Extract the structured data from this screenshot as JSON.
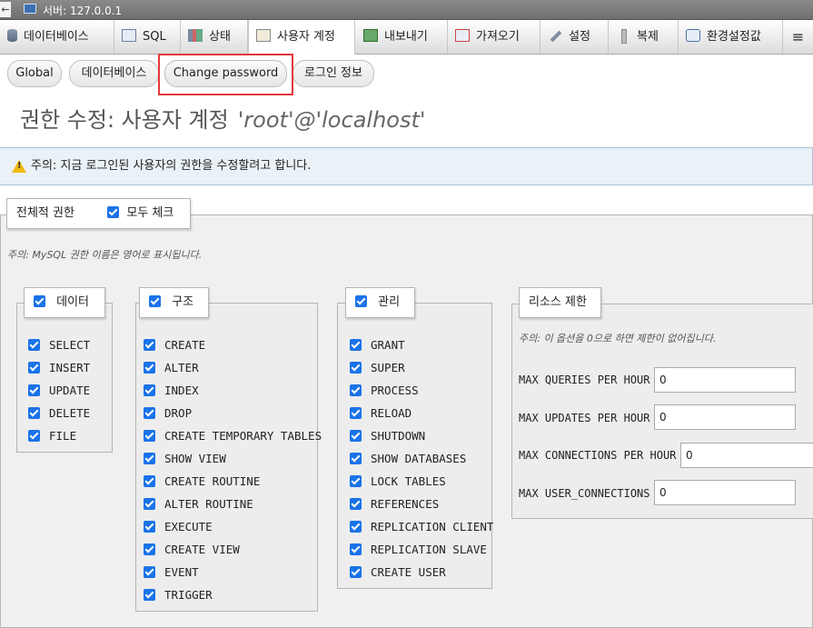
{
  "server_bar": {
    "title": "서버: 127.0.0.1"
  },
  "tabs": [
    {
      "label": "데이터베이스",
      "icon": "database-icon"
    },
    {
      "label": "SQL",
      "icon": "sql-icon"
    },
    {
      "label": "상태",
      "icon": "status-icon"
    },
    {
      "label": "사용자 계정",
      "icon": "users-icon",
      "active": true
    },
    {
      "label": "내보내기",
      "icon": "export-icon"
    },
    {
      "label": "가져오기",
      "icon": "import-icon"
    },
    {
      "label": "설정",
      "icon": "settings-icon"
    },
    {
      "label": "복제",
      "icon": "replication-icon"
    },
    {
      "label": "환경설정값",
      "icon": "variables-icon"
    },
    {
      "label": "",
      "icon": "more-icon"
    }
  ],
  "subtabs": [
    "Global",
    "데이터베이스",
    "Change password",
    "로그인 정보"
  ],
  "page": {
    "title": "권한 수정: 사용자 계정",
    "account": "'root'@'localhost'"
  },
  "notice": "주의: 지금 로그인된 사용자의 권한을 수정할려고 합니다.",
  "global": {
    "legend": "전체적 권한",
    "check_all": "모두 체크",
    "note": "주의: MySQL 권한 이름은 영어로 표시됩니다."
  },
  "groups": {
    "data": {
      "legend": "데이터",
      "items": [
        "SELECT",
        "INSERT",
        "UPDATE",
        "DELETE",
        "FILE"
      ]
    },
    "structure": {
      "legend": "구조",
      "items": [
        "CREATE",
        "ALTER",
        "INDEX",
        "DROP",
        "CREATE TEMPORARY TABLES",
        "SHOW VIEW",
        "CREATE ROUTINE",
        "ALTER ROUTINE",
        "EXECUTE",
        "CREATE VIEW",
        "EVENT",
        "TRIGGER"
      ]
    },
    "admin": {
      "legend": "관리",
      "items": [
        "GRANT",
        "SUPER",
        "PROCESS",
        "RELOAD",
        "SHUTDOWN",
        "SHOW DATABASES",
        "LOCK TABLES",
        "REFERENCES",
        "REPLICATION CLIENT",
        "REPLICATION SLAVE",
        "CREATE USER"
      ]
    }
  },
  "resources": {
    "legend": "리소스 제한",
    "note": "주의: 이 옵션을 0으로 하면 제한이 없어집니다.",
    "fields": [
      {
        "label": "MAX QUERIES PER HOUR",
        "value": "0"
      },
      {
        "label": "MAX UPDATES PER HOUR",
        "value": "0"
      },
      {
        "label": "MAX CONNECTIONS PER HOUR",
        "value": "0"
      },
      {
        "label": "MAX USER_CONNECTIONS",
        "value": "0"
      }
    ]
  },
  "colors": {
    "highlight": "#e0383a",
    "checkbox": "#1a73e8",
    "notice_bg": "#eaf1f7"
  }
}
